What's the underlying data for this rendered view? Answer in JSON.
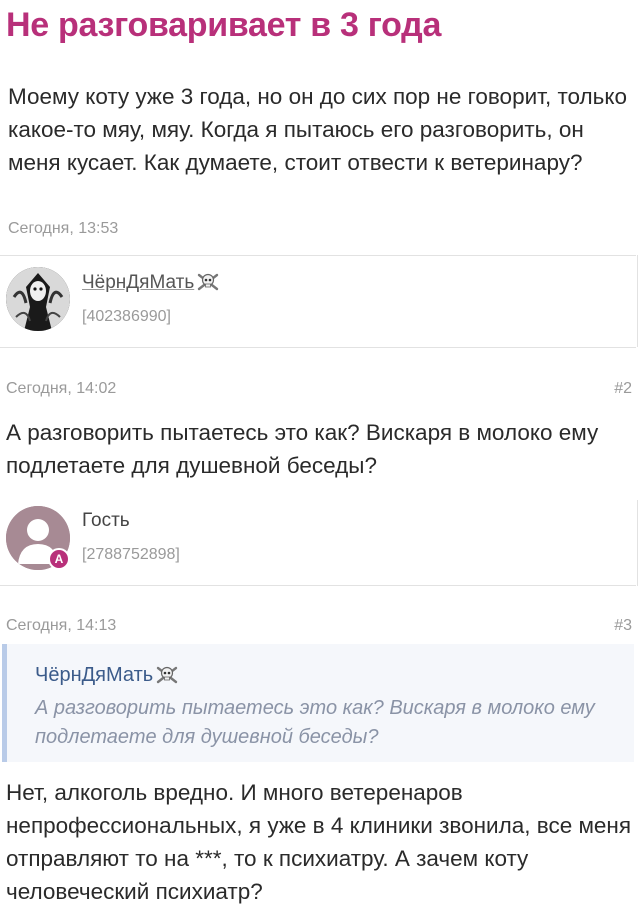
{
  "topic": {
    "title": "Не разговаривает в 3 года",
    "question": "Моему коту уже 3 года, но он до сих пор не говорит, только какое-то мяу, мяу. Когда я пытаюсь его разговорить, он меня кусает. Как думаете, стоит отвести к ветеринару?",
    "timestamp": "Сегодня, 13:53"
  },
  "posts": [
    {
      "author": "ЧёрнДяМать",
      "author_icon": "skull-icon",
      "author_id": "[402386990]",
      "timestamp": "Сегодня, 14:02",
      "number": "#2",
      "text": "А разговорить пытаетесь это как? Вискаря в молоко ему подлетаете для душевной беседы?"
    },
    {
      "author": "Гость",
      "author_badge": "A",
      "author_id": "[2788752898]",
      "timestamp": "Сегодня, 14:13",
      "number": "#3",
      "quote": {
        "author": "ЧёрнДяМать",
        "text": "А разговорить пытаетесь это как? Вискаря в молоко ему подлетаете для душевной беседы?"
      },
      "text": "Нет, алкоголь вредно. И много ветеренаров непрофессиональных, я уже в 4 клиники звонила, все меня отправляют то на ***, то к психиатру. А зачем коту человеческий психиатр?"
    }
  ],
  "colors": {
    "title": "#b8307a",
    "quote_border": "#b9cbe8",
    "guest_badge": "#b8307a"
  }
}
